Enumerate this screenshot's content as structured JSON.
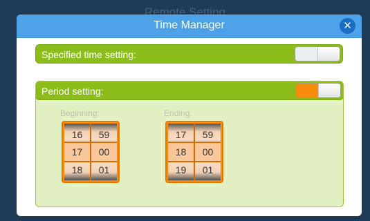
{
  "background": {
    "title": "Remote Setting"
  },
  "dialog": {
    "title": "Time Manager",
    "close_icon": "close-icon"
  },
  "specified": {
    "label": "Specified time setting:",
    "toggle_state": "off"
  },
  "period": {
    "label": "Period setting:",
    "toggle_state": "on",
    "beginning": {
      "label": "Beginning:",
      "hours": [
        "16",
        "17",
        "18"
      ],
      "minutes": [
        "59",
        "00",
        "01"
      ]
    },
    "ending": {
      "label": "Ending:",
      "hours": [
        "17",
        "18",
        "19"
      ],
      "minutes": [
        "59",
        "00",
        "01"
      ]
    }
  },
  "colors": {
    "header_blue": "#4ea2e8",
    "bar_green": "#8cbd1a",
    "toggle_orange": "#f78b0c",
    "panel_green": "#e3f0c3"
  }
}
